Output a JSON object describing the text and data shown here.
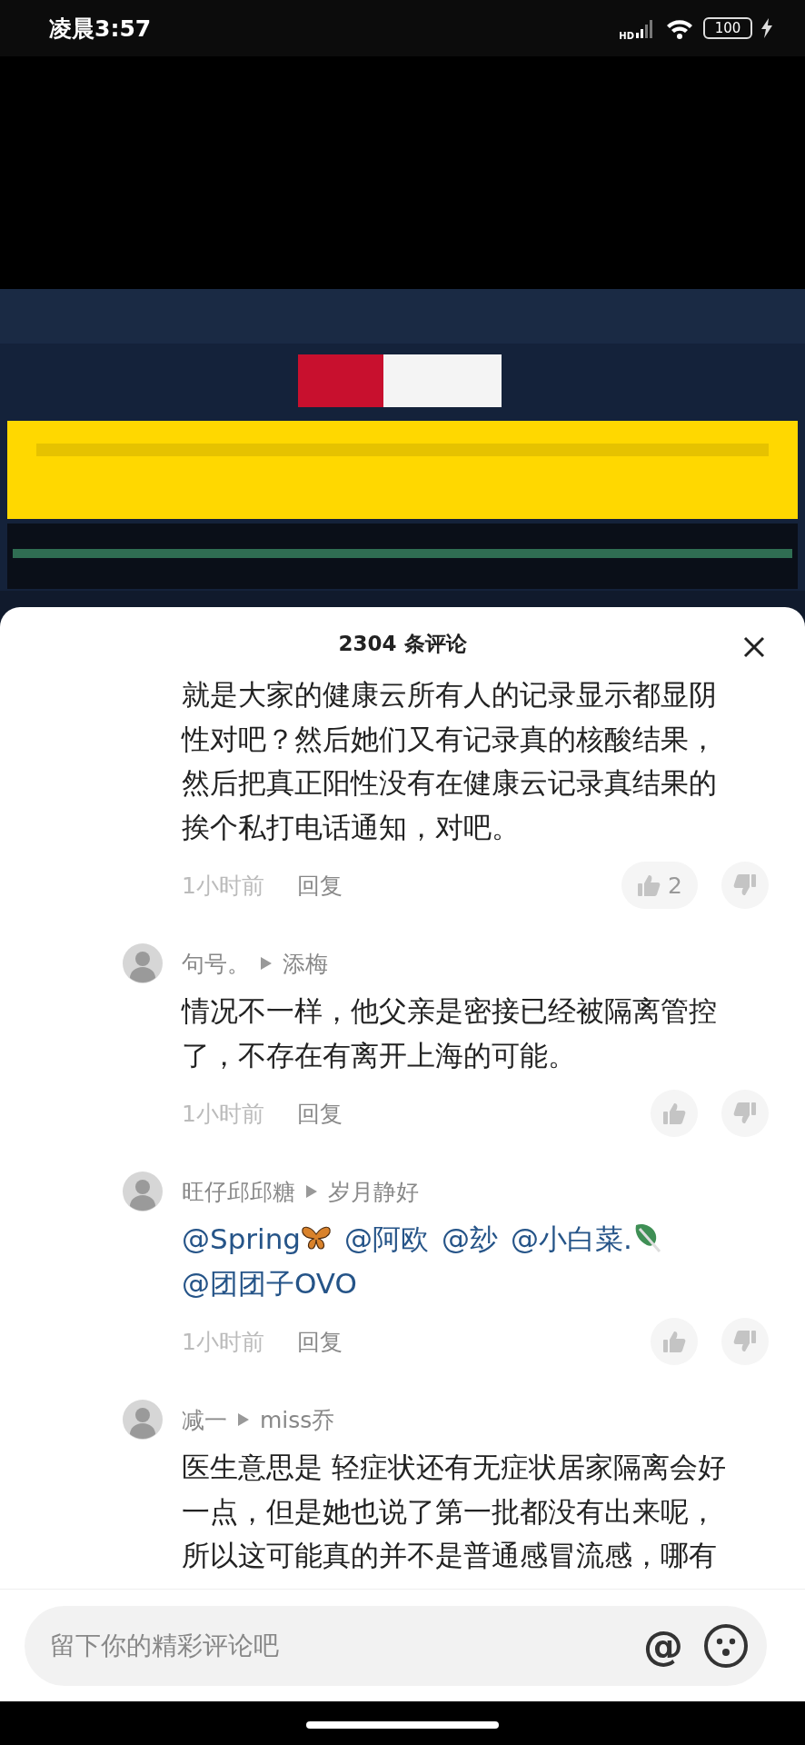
{
  "status_bar": {
    "time": "凌晨3:57",
    "network": "HD",
    "battery": "100",
    "charging": true
  },
  "comments_panel": {
    "title": "2304 条评论",
    "comments": [
      {
        "kind": "text",
        "text": "就是大家的健康云所有人的记录显示都显阴性对吧？然后她们又有记录真的核酸结果，然后把真正阳性没有在健康云记录真结果的挨个私打电话通知，对吧。",
        "time": "1小时前",
        "reply_label": "回复",
        "likes": "2"
      },
      {
        "kind": "text",
        "author": "句号。",
        "reply_to": "添梅",
        "text": "情况不一样，他父亲是密接已经被隔离管控了，不存在有离开上海的可能。",
        "time": "1小时前",
        "reply_label": "回复"
      },
      {
        "kind": "mentions",
        "author": "旺仔邱邱糖",
        "reply_to": "岁月静好",
        "mentions": [
          {
            "kind": "butterfly",
            "text": "@Spring"
          },
          {
            "kind": "plain",
            "text": "@阿欧"
          },
          {
            "kind": "plain",
            "text": "@玅"
          },
          {
            "kind": "leaf",
            "text": "@小白菜."
          },
          {
            "kind": "plain",
            "text": "@团团子OVO"
          }
        ],
        "time": "1小时前",
        "reply_label": "回复"
      },
      {
        "kind": "text",
        "author": "减一",
        "reply_to": "miss乔",
        "text": "医生意思是 轻症状还有无症状居家隔离会好一点，但是她也说了第一批都没有出来呢，所以这可能真的并不是普通感冒流感，哪有"
      }
    ]
  },
  "comment_input": {
    "placeholder": "留下你的精彩评论吧",
    "mention_button": "@"
  }
}
